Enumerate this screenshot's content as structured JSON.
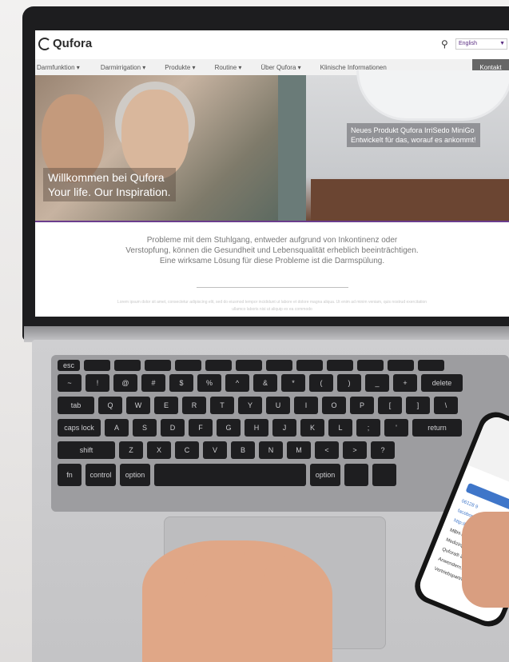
{
  "website": {
    "logo": "Qufora",
    "language": "English",
    "nav": [
      "Darmfunktion ▾",
      "Darmirrigation ▾",
      "Produkte ▾",
      "Routine ▾",
      "Über Qufora ▾",
      "Klinische Informationen"
    ],
    "contact": "Kontakt",
    "hero_left": {
      "line1": "Willkommen bei Qufora",
      "line2": "Your life. Our Inspiration."
    },
    "hero_right": {
      "line1": "Neues Produkt Qufora IrriSedo MiniGo",
      "line2": "Entwickelt für das, worauf es ankommt!"
    },
    "intro": [
      "Probleme mit dem Stuhlgang, entweder aufgrund von Inkontinenz oder",
      "Verstopfung, können die Gesundheit und Lebensqualität erheblich beeinträchtigen.",
      "Eine wirksame Lösung für diese Probleme ist die Darmspülung."
    ],
    "lorem": "Lorem ipsum dolor sit amet, consectetur adipiscing elit, sed do eiusmod tempor incididunt ut labore et dolore magna aliqua. Ut enim ad minim veniam, quis nostrud exercitation ullamco laboris nisi ut aliquip ex ea commodo"
  },
  "keyboard": {
    "row1": [
      "esc",
      "",
      "",
      "",
      "",
      "",
      "",
      "",
      "",
      "",
      "",
      "",
      ""
    ],
    "row2": [
      "~",
      "!",
      "@",
      "#",
      "$",
      "%",
      "^",
      "&",
      "*",
      "(",
      ")",
      "_",
      "+",
      "delete"
    ],
    "row3": [
      "tab",
      "Q",
      "W",
      "E",
      "R",
      "T",
      "Y",
      "U",
      "I",
      "O",
      "P",
      "[",
      "]",
      "\\"
    ],
    "row4": [
      "caps lock",
      "A",
      "S",
      "D",
      "F",
      "G",
      "H",
      "J",
      "K",
      "L",
      ";",
      "'",
      "return"
    ],
    "row5": [
      "shift",
      "Z",
      "X",
      "C",
      "V",
      "B",
      "N",
      "M",
      "<",
      ">",
      "?"
    ],
    "row6": [
      "fn",
      "control",
      "option",
      "",
      "option",
      "",
      ""
    ]
  },
  "phone": {
    "lines": [
      "06128 9",
      "facebook",
      "http://www",
      "MBH-Internat",
      "Medizinprodukt",
      "Qufora® in Engla",
      "Anwendern, medi",
      "Vertriebspartnern"
    ]
  }
}
